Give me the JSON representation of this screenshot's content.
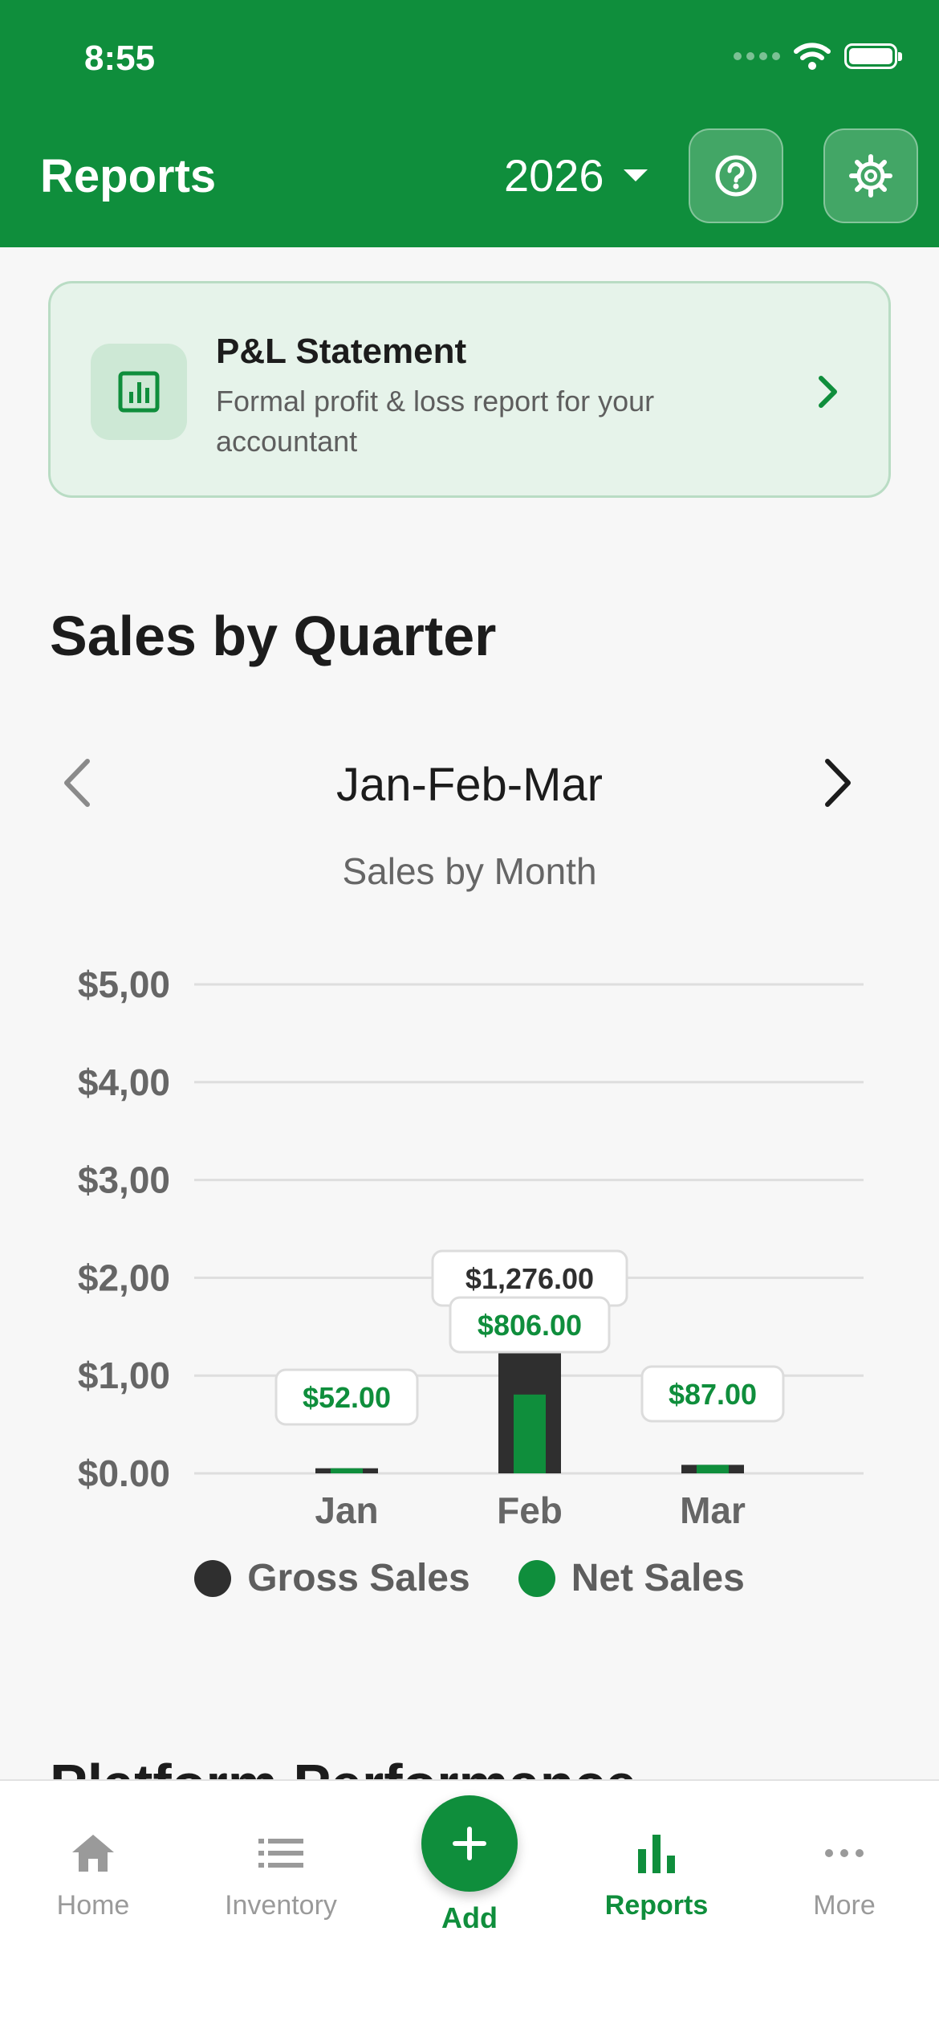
{
  "status_bar": {
    "time": "8:55"
  },
  "header": {
    "title": "Reports",
    "year": "2026",
    "help_icon": "help-circle-icon",
    "settings_icon": "gear-icon"
  },
  "pl_card": {
    "title": "P&L Statement",
    "subtitle": "Formal profit & loss report for your accountant",
    "icon": "bar-chart-icon"
  },
  "section": {
    "title": "Sales by Quarter",
    "quarter_label": "Jan-Feb-Mar",
    "chart_title": "Sales by Month"
  },
  "chart_data": {
    "type": "bar",
    "title": "Sales by Month",
    "categories": [
      "Jan",
      "Feb",
      "Mar"
    ],
    "y_tick_labels": [
      "$0.00",
      "$1,00",
      "$2,00",
      "$3,00",
      "$4,00",
      "$5,00"
    ],
    "ylim": [
      0,
      5000
    ],
    "grid": true,
    "legend_position": "bottom",
    "series": [
      {
        "name": "Gross Sales",
        "color": "#2f2f2f",
        "values": [
          52,
          1276,
          87
        ],
        "labels": [
          null,
          "$1,276.00",
          null
        ]
      },
      {
        "name": "Net Sales",
        "color": "#0f8e3c",
        "values": [
          52,
          806,
          87
        ],
        "labels": [
          "$52.00",
          "$806.00",
          "$87.00"
        ]
      }
    ]
  },
  "next_section": {
    "title": "Platform Performance"
  },
  "tabbar": {
    "items": [
      {
        "label": "Home",
        "icon": "home-icon"
      },
      {
        "label": "Inventory",
        "icon": "list-icon"
      },
      {
        "label": "Add",
        "icon": "plus-icon"
      },
      {
        "label": "Reports",
        "icon": "bar-chart-icon"
      },
      {
        "label": "More",
        "icon": "more-icon"
      }
    ],
    "active": "Reports"
  },
  "colors": {
    "brand": "#0f8e3c",
    "gross": "#2f2f2f",
    "net": "#0f8e3c"
  }
}
